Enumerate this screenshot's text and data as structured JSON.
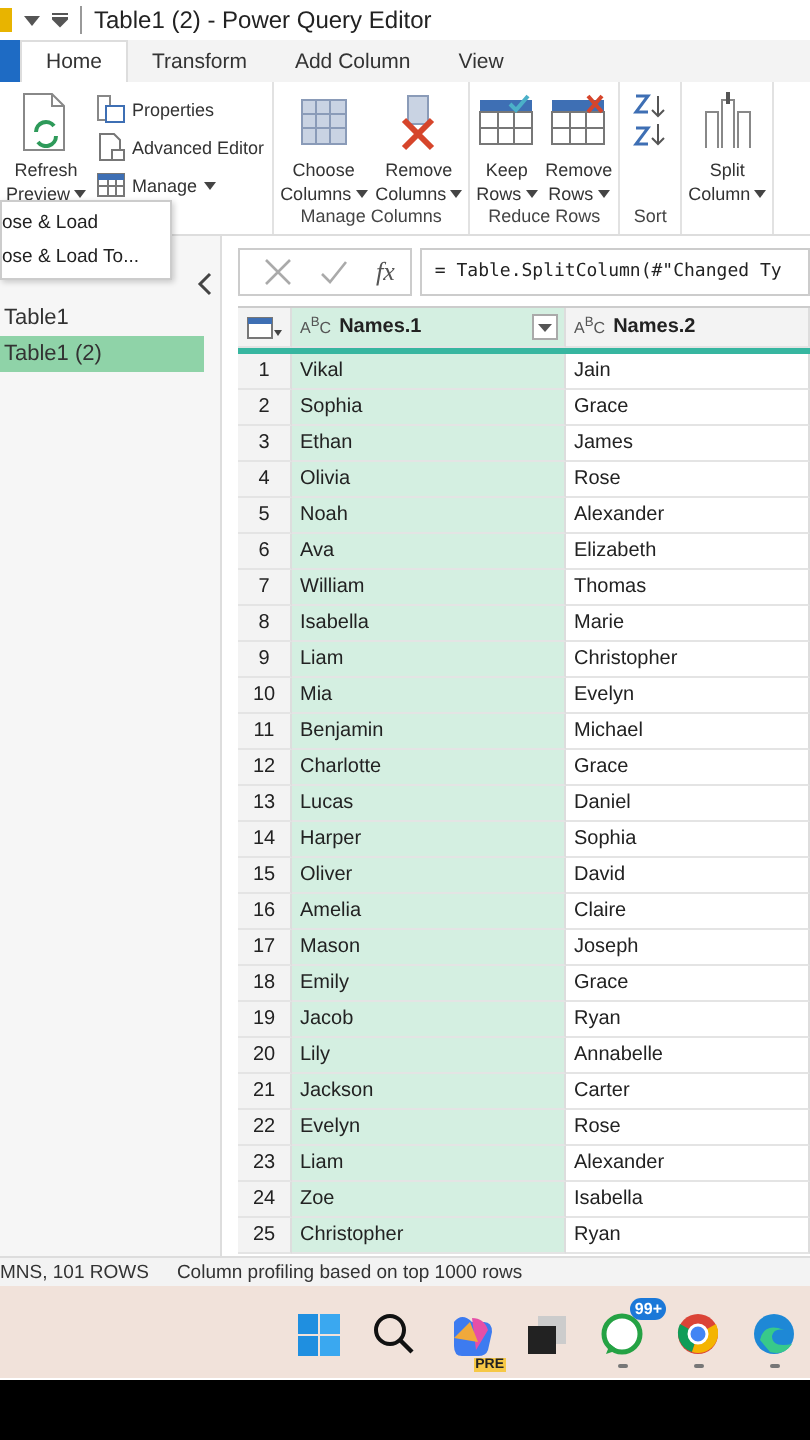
{
  "title_bar": {
    "title": "Table1 (2) - Power Query Editor"
  },
  "tabs": [
    {
      "label": "Home",
      "selected": true
    },
    {
      "label": "Transform",
      "selected": false
    },
    {
      "label": "Add Column",
      "selected": false
    },
    {
      "label": "View",
      "selected": false
    }
  ],
  "ribbon": {
    "groups": [
      {
        "buttons": [
          {
            "kind": "refresh",
            "label": "Refresh\nPreview",
            "dropdown": true
          }
        ],
        "small": [
          {
            "kind": "properties",
            "label": "Properties",
            "dropdown": false
          },
          {
            "kind": "advanced-editor",
            "label": "Advanced Editor",
            "dropdown": false
          },
          {
            "kind": "manage",
            "label": "Manage",
            "dropdown": true
          }
        ]
      },
      {
        "label": "Manage Columns",
        "buttons": [
          {
            "kind": "choose-columns",
            "label": "Choose\nColumns",
            "dropdown": true
          },
          {
            "kind": "remove-columns",
            "label": "Remove\nColumns",
            "dropdown": true
          }
        ]
      },
      {
        "label": "Reduce Rows",
        "buttons": [
          {
            "kind": "keep-rows",
            "label": "Keep\nRows",
            "dropdown": true
          },
          {
            "kind": "remove-rows",
            "label": "Remove\nRows",
            "dropdown": true
          }
        ]
      },
      {
        "label": "Sort",
        "buttons": [
          {
            "kind": "sort"
          }
        ]
      },
      {
        "buttons": [
          {
            "kind": "split-column",
            "label": "Split\nColumn",
            "dropdown": true
          }
        ]
      }
    ]
  },
  "menu": {
    "items": [
      "ose & Load",
      "ose & Load To..."
    ]
  },
  "queries": [
    {
      "name": "Table1",
      "selected": false
    },
    {
      "name": "Table1 (2)",
      "selected": true
    }
  ],
  "formula_bar": {
    "fx": "fx",
    "formula": "= Table.SplitColumn(#\"Changed Ty"
  },
  "table": {
    "columns": [
      {
        "name": "Names.1",
        "type": "A$^{B}$C",
        "selected": true,
        "filter": true
      },
      {
        "name": "Names.2",
        "type": "A$^{B}$C",
        "selected": false,
        "filter": false
      }
    ],
    "rows": [
      {
        "number": "1",
        "cells": [
          "Vikal",
          "Jain"
        ]
      },
      {
        "number": "2",
        "cells": [
          "Sophia",
          "Grace"
        ]
      },
      {
        "number": "3",
        "cells": [
          "Ethan",
          "James"
        ]
      },
      {
        "number": "4",
        "cells": [
          "Olivia",
          "Rose"
        ]
      },
      {
        "number": "5",
        "cells": [
          "Noah",
          "Alexander"
        ]
      },
      {
        "number": "6",
        "cells": [
          "Ava",
          "Elizabeth"
        ]
      },
      {
        "number": "7",
        "cells": [
          "William",
          "Thomas"
        ]
      },
      {
        "number": "8",
        "cells": [
          "Isabella",
          "Marie"
        ]
      },
      {
        "number": "9",
        "cells": [
          "Liam",
          "Christopher"
        ]
      },
      {
        "number": "10",
        "cells": [
          "Mia",
          "Evelyn"
        ]
      },
      {
        "number": "11",
        "cells": [
          "Benjamin",
          "Michael"
        ]
      },
      {
        "number": "12",
        "cells": [
          "Charlotte",
          "Grace"
        ]
      },
      {
        "number": "13",
        "cells": [
          "Lucas",
          "Daniel"
        ]
      },
      {
        "number": "14",
        "cells": [
          "Harper",
          "Sophia"
        ]
      },
      {
        "number": "15",
        "cells": [
          "Oliver",
          "David"
        ]
      },
      {
        "number": "16",
        "cells": [
          "Amelia",
          "Claire"
        ]
      },
      {
        "number": "17",
        "cells": [
          "Mason",
          "Joseph"
        ]
      },
      {
        "number": "18",
        "cells": [
          "Emily",
          "Grace"
        ]
      },
      {
        "number": "19",
        "cells": [
          "Jacob",
          "Ryan"
        ]
      },
      {
        "number": "20",
        "cells": [
          "Lily",
          "Annabelle"
        ]
      },
      {
        "number": "21",
        "cells": [
          "Jackson",
          "Carter"
        ]
      },
      {
        "number": "22",
        "cells": [
          "Evelyn",
          "Rose"
        ]
      },
      {
        "number": "23",
        "cells": [
          "Liam",
          "Alexander"
        ]
      },
      {
        "number": "24",
        "cells": [
          "Zoe",
          "Isabella"
        ]
      },
      {
        "number": "25",
        "cells": [
          "Christopher",
          "Ryan"
        ]
      }
    ]
  },
  "status_bar": [
    "MNS, 101 ROWS",
    "Column profiling based on top 1000 rows"
  ],
  "taskbar": [
    {
      "kind": "start",
      "running": false
    },
    {
      "kind": "search",
      "running": false
    },
    {
      "kind": "copilot",
      "badge": "PRE",
      "running": false
    },
    {
      "kind": "task-view",
      "running": false
    },
    {
      "kind": "whatsapp",
      "badge": "99+",
      "running": true
    },
    {
      "kind": "chrome",
      "running": true
    },
    {
      "kind": "edge",
      "running": true
    }
  ]
}
